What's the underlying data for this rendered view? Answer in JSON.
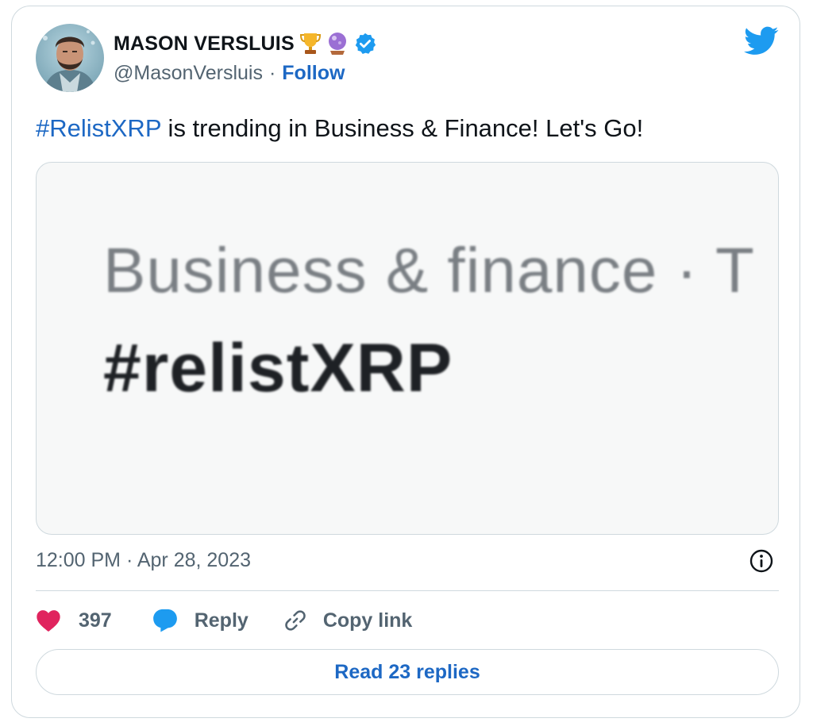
{
  "author": {
    "name": "MASON VERSLUIS",
    "handle": "@MasonVersluis",
    "separator": "·",
    "follow_label": "Follow",
    "badges": [
      "trophy-icon",
      "crystal-ball-icon",
      "verified-badge-icon"
    ]
  },
  "tweet": {
    "hashtag": "#RelistXRP",
    "text": " is trending in Business & Finance! Let's Go!",
    "timestamp": "12:00 PM · Apr 28, 2023"
  },
  "media": {
    "line1": "Business & finance · T",
    "line2": "#relistXRP"
  },
  "actions": {
    "like_count": "397",
    "reply_label": "Reply",
    "copy_label": "Copy link"
  },
  "footer": {
    "read_replies_label": "Read 23 replies"
  },
  "colors": {
    "link_blue": "#1d68c4",
    "twitter_blue": "#1d9bf0",
    "heart_pink": "#e0245e",
    "muted_gray": "#536471",
    "border": "#cfd9de"
  }
}
